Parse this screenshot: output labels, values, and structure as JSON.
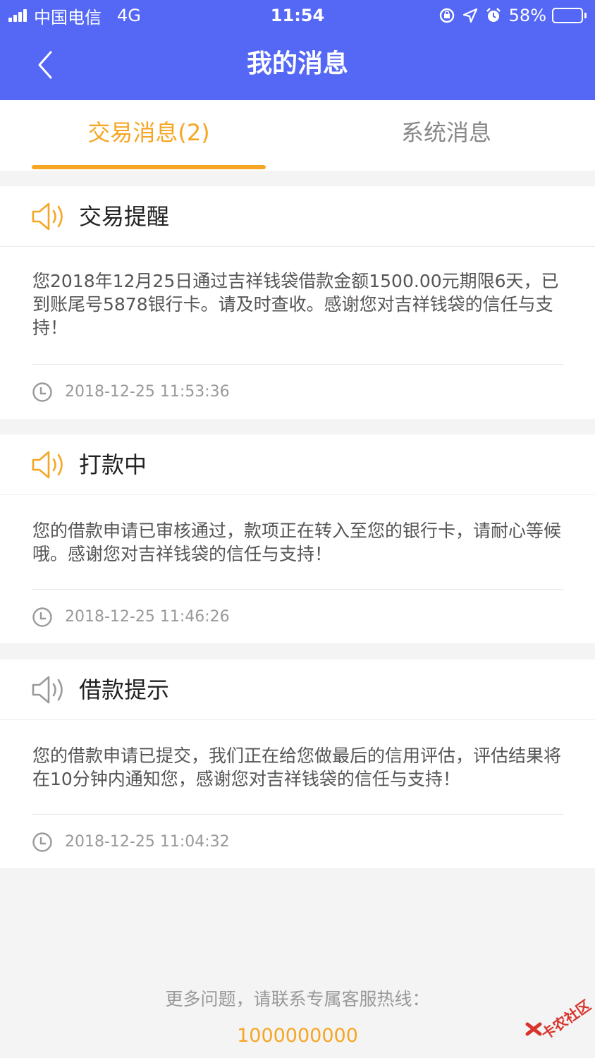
{
  "status_bar": {
    "carrier": "中国电信",
    "network": "4G",
    "time": "11:54",
    "battery_percent": "58%",
    "battery_level": 0.58
  },
  "header": {
    "title": "我的消息",
    "back_icon": "chevron-left-icon"
  },
  "tabs": [
    {
      "label": "交易消息(2)",
      "active": true
    },
    {
      "label": "系统消息",
      "active": false
    }
  ],
  "colors": {
    "header_bg": "#5468f5",
    "accent": "#f6a623",
    "inactive_icon": "#9a9a9a"
  },
  "messages": [
    {
      "title": "交易提醒",
      "icon": "speaker-icon",
      "unread": true,
      "body": "您2018年12月25日通过吉祥钱袋借款金额1500.00元期限6天，已到账尾号5878银行卡。请及时查收。感谢您对吉祥钱袋的信任与支持！",
      "time": "2018-12-25 11:53:36"
    },
    {
      "title": "打款中",
      "icon": "speaker-icon",
      "unread": true,
      "body": "您的借款申请已审核通过，款项正在转入至您的银行卡，请耐心等候哦。感谢您对吉祥钱袋的信任与支持！",
      "time": "2018-12-25 11:46:26"
    },
    {
      "title": "借款提示",
      "icon": "speaker-icon",
      "unread": false,
      "body": "您的借款申请已提交，我们正在给您做最后的信用评估，评估结果将在10分钟内通知您，感谢您对吉祥钱袋的信任与支持！",
      "time": "2018-12-25 11:04:32"
    }
  ],
  "footer": {
    "hint": "更多问题，请联系专属客服热线：",
    "phone": "1000000000"
  },
  "watermark": {
    "text": "卡农社区"
  }
}
